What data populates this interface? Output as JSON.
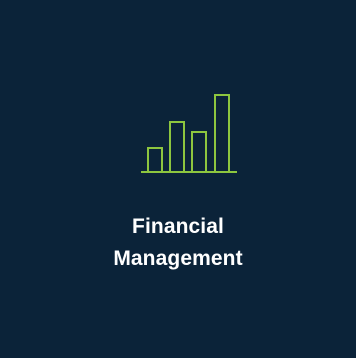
{
  "tile": {
    "background_color": "#0b2339",
    "accent_color": "#8dc63f",
    "text_color": "#ffffff",
    "icon": "bar-chart-icon",
    "title_line1": "Financial",
    "title_line2": "Management"
  }
}
